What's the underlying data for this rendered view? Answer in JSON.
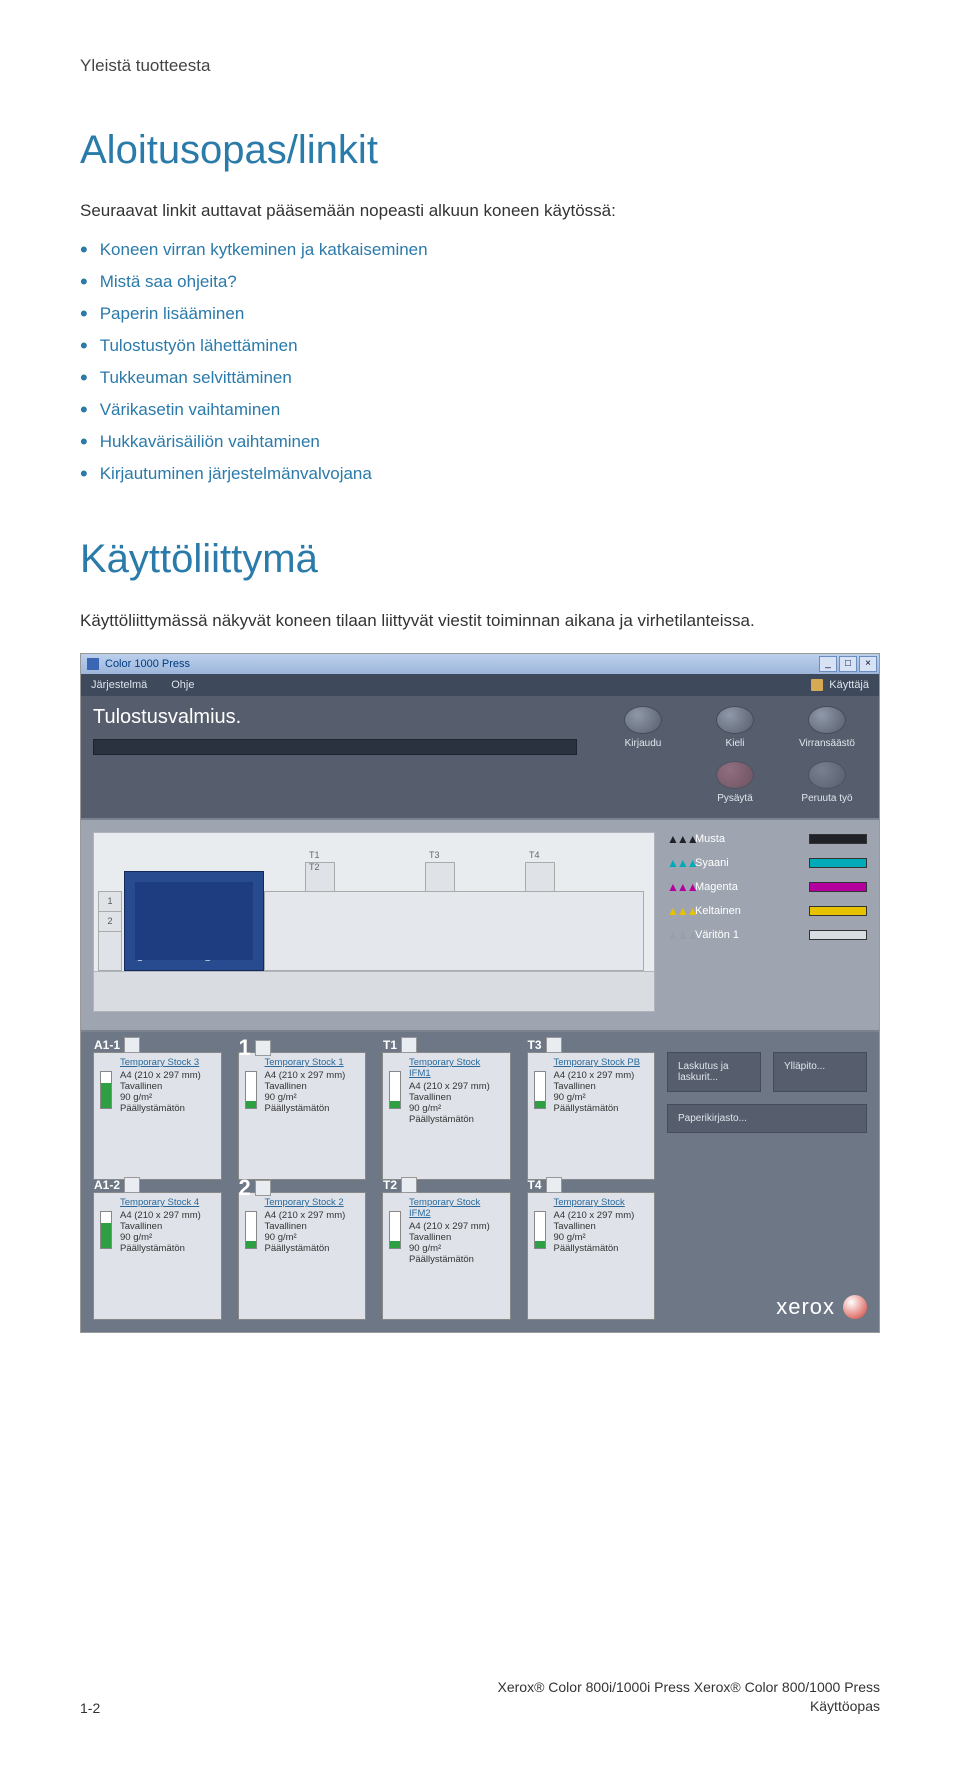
{
  "header": "Yleistä tuotteesta",
  "section1": {
    "title": "Aloitusopas/linkit",
    "intro": "Seuraavat linkit auttavat pääsemään nopeasti alkuun koneen käytössä:",
    "links": [
      "Koneen virran kytkeminen ja katkaiseminen",
      "Mistä saa ohjeita?",
      "Paperin lisääminen",
      "Tulostustyön lähettäminen",
      "Tukkeuman selvittäminen",
      "Värikasetin vaihtaminen",
      "Hukkavärisäiliön vaihtaminen",
      "Kirjautuminen järjestelmänvalvojana"
    ]
  },
  "section2": {
    "title": "Käyttöliittymä",
    "body": "Käyttöliittymässä näkyvät koneen tilaan liittyvät viestit toiminnan aikana ja virhetilanteissa."
  },
  "ui": {
    "title_bar": "Color 1000 Press",
    "menu": {
      "system": "Järjestelmä",
      "help": "Ohje",
      "user": "Käyttäjä"
    },
    "status": "Tulostusvalmius.",
    "buttons_top": [
      {
        "label": "Kirjaudu"
      },
      {
        "label": "Kieli"
      },
      {
        "label": "Virransäästö"
      }
    ],
    "buttons_bottom": [
      {
        "label": "Pysäytä"
      },
      {
        "label": "Peruuta työ"
      }
    ],
    "diagram": {
      "feeder_slots": [
        "1",
        "2"
      ],
      "tower_labels": [
        "T1",
        "T2",
        "T3",
        "T4"
      ]
    },
    "toners": [
      {
        "label": "Musta",
        "color": "#202228",
        "icon": "#202228"
      },
      {
        "label": "Syaani",
        "color": "#00aab8",
        "icon": "#00aab8"
      },
      {
        "label": "Magenta",
        "color": "#b4009e",
        "icon": "#b4009e"
      },
      {
        "label": "Keltainen",
        "color": "#e6c200",
        "icon": "#e6c200"
      },
      {
        "label": "Väritön 1",
        "color": "#d9dde2",
        "icon": "#9aa0aa"
      }
    ],
    "util": {
      "billing": "Laskutus ja laskurit...",
      "maintenance": "Ylläpito...",
      "paperlib": "Paperikirjasto..."
    },
    "trays": [
      {
        "id": "A1-1",
        "big": "",
        "stock": "Temporary Stock 3",
        "size": "A4 (210 x 297 mm)",
        "type": "Tavallinen",
        "weight": "90 g/m²  Päällystämätön",
        "level": 70
      },
      {
        "id": "",
        "big": "1",
        "stock": "Temporary Stock 1",
        "size": "A4 (210 x 297 mm)",
        "type": "Tavallinen",
        "weight": "90 g/m²  Päällystämätön",
        "level": 20
      },
      {
        "id": "T1",
        "big": "",
        "stock": "Temporary Stock IFM1",
        "size": "A4 (210 x 297 mm)",
        "type": "Tavallinen",
        "weight": "90 g/m²  Päällystämätön",
        "level": 20
      },
      {
        "id": "T3",
        "big": "",
        "stock": "Temporary Stock PB",
        "size": "A4 (210 x 297 mm)",
        "type": "Tavallinen",
        "weight": "90 g/m²  Päällystämätön",
        "level": 20
      },
      {
        "id": "A1-2",
        "big": "",
        "stock": "Temporary Stock 4",
        "size": "A4 (210 x 297 mm)",
        "type": "Tavallinen",
        "weight": "90 g/m²  Päällystämätön",
        "level": 70
      },
      {
        "id": "",
        "big": "2",
        "stock": "Temporary Stock 2",
        "size": "A4 (210 x 297 mm)",
        "type": "Tavallinen",
        "weight": "90 g/m²  Päällystämätön",
        "level": 20
      },
      {
        "id": "T2",
        "big": "",
        "stock": "Temporary Stock IFM2",
        "size": "A4 (210 x 297 mm)",
        "type": "Tavallinen",
        "weight": "90 g/m²  Päällystämätön",
        "level": 20
      },
      {
        "id": "T4",
        "big": "",
        "stock": "Temporary Stock",
        "size": "A4 (210 x 297 mm)",
        "type": "Tavallinen",
        "weight": "90 g/m²  Päällystämätön",
        "level": 20
      }
    ],
    "logo": "xerox"
  },
  "footer": {
    "page": "1-2",
    "product": "Xerox® Color 800i/1000i Press Xerox® Color 800/1000 Press",
    "doc": "Käyttöopas"
  }
}
